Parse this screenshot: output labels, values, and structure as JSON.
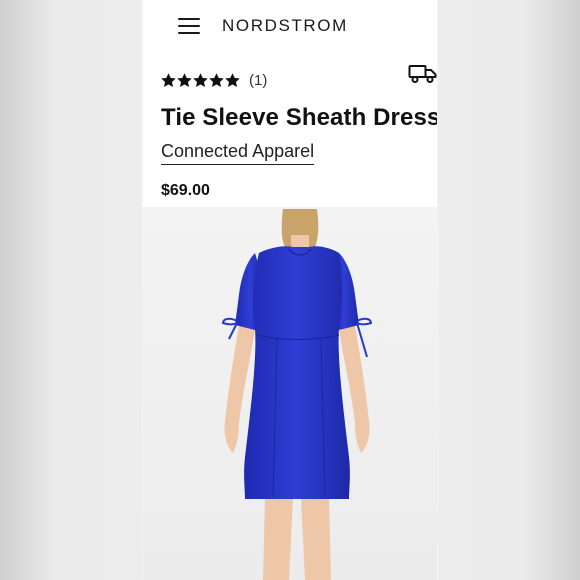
{
  "header": {
    "menu_icon": "hamburger-menu-icon",
    "logo": "NORDSTROM"
  },
  "product": {
    "rating": {
      "stars": 5,
      "max_stars": 5,
      "count": "(1)"
    },
    "title": "Tie Sleeve Sheath Dress",
    "brand": "Connected Apparel",
    "price": "$69.00",
    "image": {
      "dress_color": "#2a37c8",
      "background": "#f2f2f2"
    }
  },
  "icons": {
    "shipping": "delivery-truck-icon",
    "star": "star-icon"
  },
  "colors": {
    "text": "#111111",
    "accent": "#2a37c8"
  }
}
